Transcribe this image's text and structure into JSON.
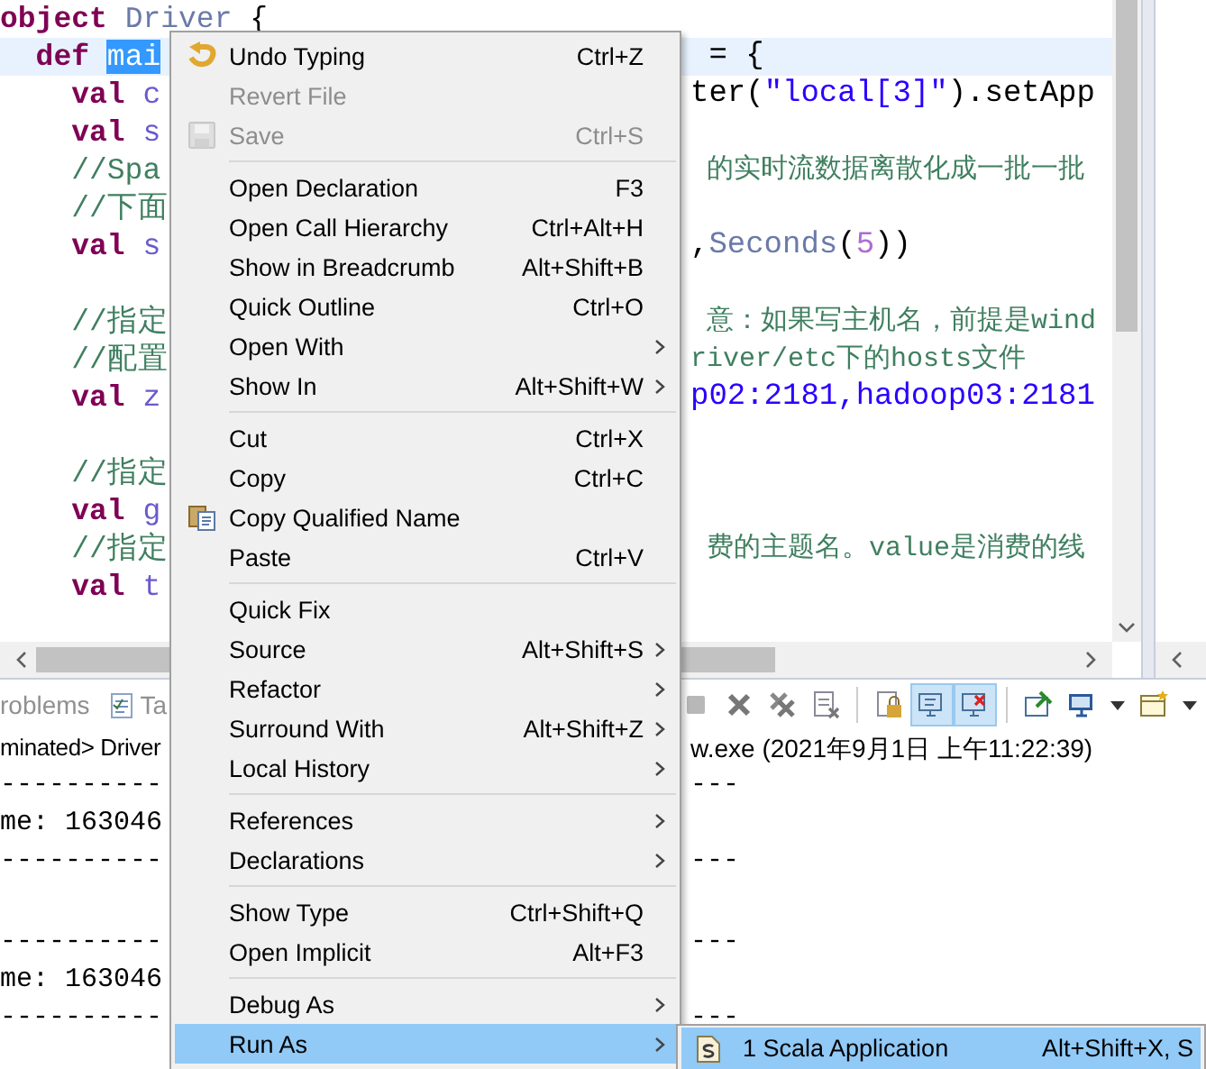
{
  "editor": {
    "lines": [
      {
        "current": false,
        "left": [
          {
            "kind": "keyword",
            "text": "object"
          },
          {
            "kind": "type",
            "text": " Driver"
          },
          {
            "kind": "plain",
            "text": " {"
          }
        ]
      },
      {
        "current": true,
        "left": [
          {
            "kind": "keyword",
            "text": "  def "
          },
          {
            "kind": "selection",
            "text": "mai"
          }
        ],
        "right": [
          {
            "kind": "plain",
            "text": " = {"
          }
        ]
      },
      {
        "current": false,
        "left": [
          {
            "kind": "keyword",
            "text": "    val"
          },
          {
            "kind": "ident",
            "text": " c"
          }
        ],
        "right": [
          {
            "kind": "plain",
            "text": "ter("
          },
          {
            "kind": "string",
            "text": "\"local[3]\""
          },
          {
            "kind": "plain",
            "text": ").setApp"
          }
        ]
      },
      {
        "current": false,
        "left": [
          {
            "kind": "keyword",
            "text": "    val"
          },
          {
            "kind": "ident",
            "text": " s"
          }
        ]
      },
      {
        "current": false,
        "left": [
          {
            "kind": "comment",
            "text": "    //Spa"
          }
        ],
        "right": [
          {
            "kind": "comment",
            "text": " 的实时流数据离散化成一批一批"
          }
        ]
      },
      {
        "current": false,
        "left": [
          {
            "kind": "comment",
            "text": "    //下面"
          }
        ]
      },
      {
        "current": false,
        "left": [
          {
            "kind": "keyword",
            "text": "    val"
          },
          {
            "kind": "ident",
            "text": " s"
          }
        ],
        "right": [
          {
            "kind": "plain",
            "text": ","
          },
          {
            "kind": "type",
            "text": "Seconds"
          },
          {
            "kind": "plain",
            "text": "("
          },
          {
            "kind": "number",
            "text": "5"
          },
          {
            "kind": "plain",
            "text": "))"
          }
        ]
      },
      {
        "current": false
      },
      {
        "current": false,
        "left": [
          {
            "kind": "comment",
            "text": "    //指定"
          }
        ],
        "right": [
          {
            "kind": "comment",
            "text": " 意：如果写主机名，前提是wind"
          }
        ]
      },
      {
        "current": false,
        "left": [
          {
            "kind": "comment",
            "text": "    //配置"
          }
        ],
        "right": [
          {
            "kind": "comment",
            "text": "river/etc下的hosts文件"
          }
        ]
      },
      {
        "current": false,
        "left": [
          {
            "kind": "keyword",
            "text": "    val"
          },
          {
            "kind": "ident",
            "text": " z"
          }
        ],
        "right": [
          {
            "kind": "string",
            "text": "p02:2181,hadoop03:2181"
          }
        ]
      },
      {
        "current": false
      },
      {
        "current": false,
        "left": [
          {
            "kind": "comment",
            "text": "    //指定"
          }
        ]
      },
      {
        "current": false,
        "left": [
          {
            "kind": "keyword",
            "text": "    val"
          },
          {
            "kind": "ident",
            "text": " g"
          }
        ]
      },
      {
        "current": false,
        "left": [
          {
            "kind": "comment",
            "text": "    //指定"
          }
        ],
        "right": [
          {
            "kind": "comment",
            "text": " 费的主题名。value是消费的线"
          }
        ]
      },
      {
        "current": false,
        "left": [
          {
            "kind": "keyword",
            "text": "    val"
          },
          {
            "kind": "ident",
            "text": " t"
          }
        ]
      }
    ]
  },
  "bottom_panel": {
    "tabs": [
      {
        "label": "roblems",
        "selected": false
      },
      {
        "label": "Ta",
        "selected": false
      }
    ],
    "toolbar": [
      {
        "kind": "stop",
        "on": false
      },
      {
        "kind": "remove",
        "on": false
      },
      {
        "kind": "remove-all",
        "on": false
      },
      {
        "kind": "clear",
        "on": false
      },
      {
        "kind": "lock",
        "on": false
      },
      {
        "kind": "pin-console",
        "on": true
      },
      {
        "kind": "show-error",
        "on": true
      },
      {
        "kind": "pin",
        "on": false
      },
      {
        "kind": "display",
        "on": false
      },
      {
        "kind": "new-console",
        "on": false
      }
    ],
    "status_left": "minated> Driver",
    "status_right": "w.exe (2021年9月1日 上午11:22:39)",
    "console": [
      {
        "kind": "text",
        "left": "----------",
        "right": "---"
      },
      {
        "kind": "text",
        "left": "me: 163046"
      },
      {
        "kind": "text",
        "left": "----------",
        "right": "---"
      },
      {
        "kind": "blank"
      },
      {
        "kind": "text",
        "left": "----------",
        "right": "---"
      },
      {
        "kind": "text",
        "left": "me: 163046"
      },
      {
        "kind": "text",
        "left": "----------",
        "right": "---"
      }
    ]
  },
  "context_menu": {
    "groups": [
      [
        {
          "label": "Undo Typing",
          "shortcut": "Ctrl+Z",
          "disabled": false,
          "submenu": false,
          "selected": false
        },
        {
          "label": "Revert File",
          "disabled": true,
          "submenu": false,
          "selected": false
        },
        {
          "label": "Save",
          "shortcut": "Ctrl+S",
          "disabled": true,
          "submenu": false,
          "selected": false
        }
      ],
      [
        {
          "label": "Open Declaration",
          "shortcut": "F3",
          "disabled": false,
          "submenu": false,
          "selected": false
        },
        {
          "label": "Open Call Hierarchy",
          "shortcut": "Ctrl+Alt+H",
          "disabled": false,
          "submenu": false,
          "selected": false
        },
        {
          "label": "Show in Breadcrumb",
          "shortcut": "Alt+Shift+B",
          "disabled": false,
          "submenu": false,
          "selected": false
        },
        {
          "label": "Quick Outline",
          "shortcut": "Ctrl+O",
          "disabled": false,
          "submenu": false,
          "selected": false
        },
        {
          "label": "Open With",
          "disabled": false,
          "submenu": true,
          "selected": false
        },
        {
          "label": "Show In",
          "shortcut": "Alt+Shift+W",
          "disabled": false,
          "submenu": true,
          "selected": false
        }
      ],
      [
        {
          "label": "Cut",
          "shortcut": "Ctrl+X",
          "disabled": false,
          "submenu": false,
          "selected": false
        },
        {
          "label": "Copy",
          "shortcut": "Ctrl+C",
          "disabled": false,
          "submenu": false,
          "selected": false
        },
        {
          "label": "Copy Qualified Name",
          "disabled": false,
          "submenu": false,
          "selected": false
        },
        {
          "label": "Paste",
          "shortcut": "Ctrl+V",
          "disabled": false,
          "submenu": false,
          "selected": false
        }
      ],
      [
        {
          "label": "Quick Fix",
          "disabled": false,
          "submenu": false,
          "selected": false
        },
        {
          "label": "Source",
          "shortcut": "Alt+Shift+S",
          "disabled": false,
          "submenu": true,
          "selected": false
        },
        {
          "label": "Refactor",
          "disabled": false,
          "submenu": true,
          "selected": false
        },
        {
          "label": "Surround With",
          "shortcut": "Alt+Shift+Z",
          "disabled": false,
          "submenu": true,
          "selected": false
        },
        {
          "label": "Local History",
          "disabled": false,
          "submenu": true,
          "selected": false
        }
      ],
      [
        {
          "label": "References",
          "disabled": false,
          "submenu": true,
          "selected": false
        },
        {
          "label": "Declarations",
          "disabled": false,
          "submenu": true,
          "selected": false
        }
      ],
      [
        {
          "label": "Show Type",
          "shortcut": "Ctrl+Shift+Q",
          "disabled": false,
          "submenu": false,
          "selected": false
        },
        {
          "label": "Open Implicit",
          "shortcut": "Alt+F3",
          "disabled": false,
          "submenu": false,
          "selected": false
        }
      ],
      [
        {
          "label": "Debug As",
          "disabled": false,
          "submenu": true,
          "selected": false
        },
        {
          "label": "Run As",
          "disabled": false,
          "submenu": true,
          "selected": true
        }
      ]
    ]
  },
  "submenu": {
    "items": [
      {
        "label": "1 Scala Application",
        "shortcut": "Alt+Shift+X, S",
        "selected": true
      }
    ]
  }
}
